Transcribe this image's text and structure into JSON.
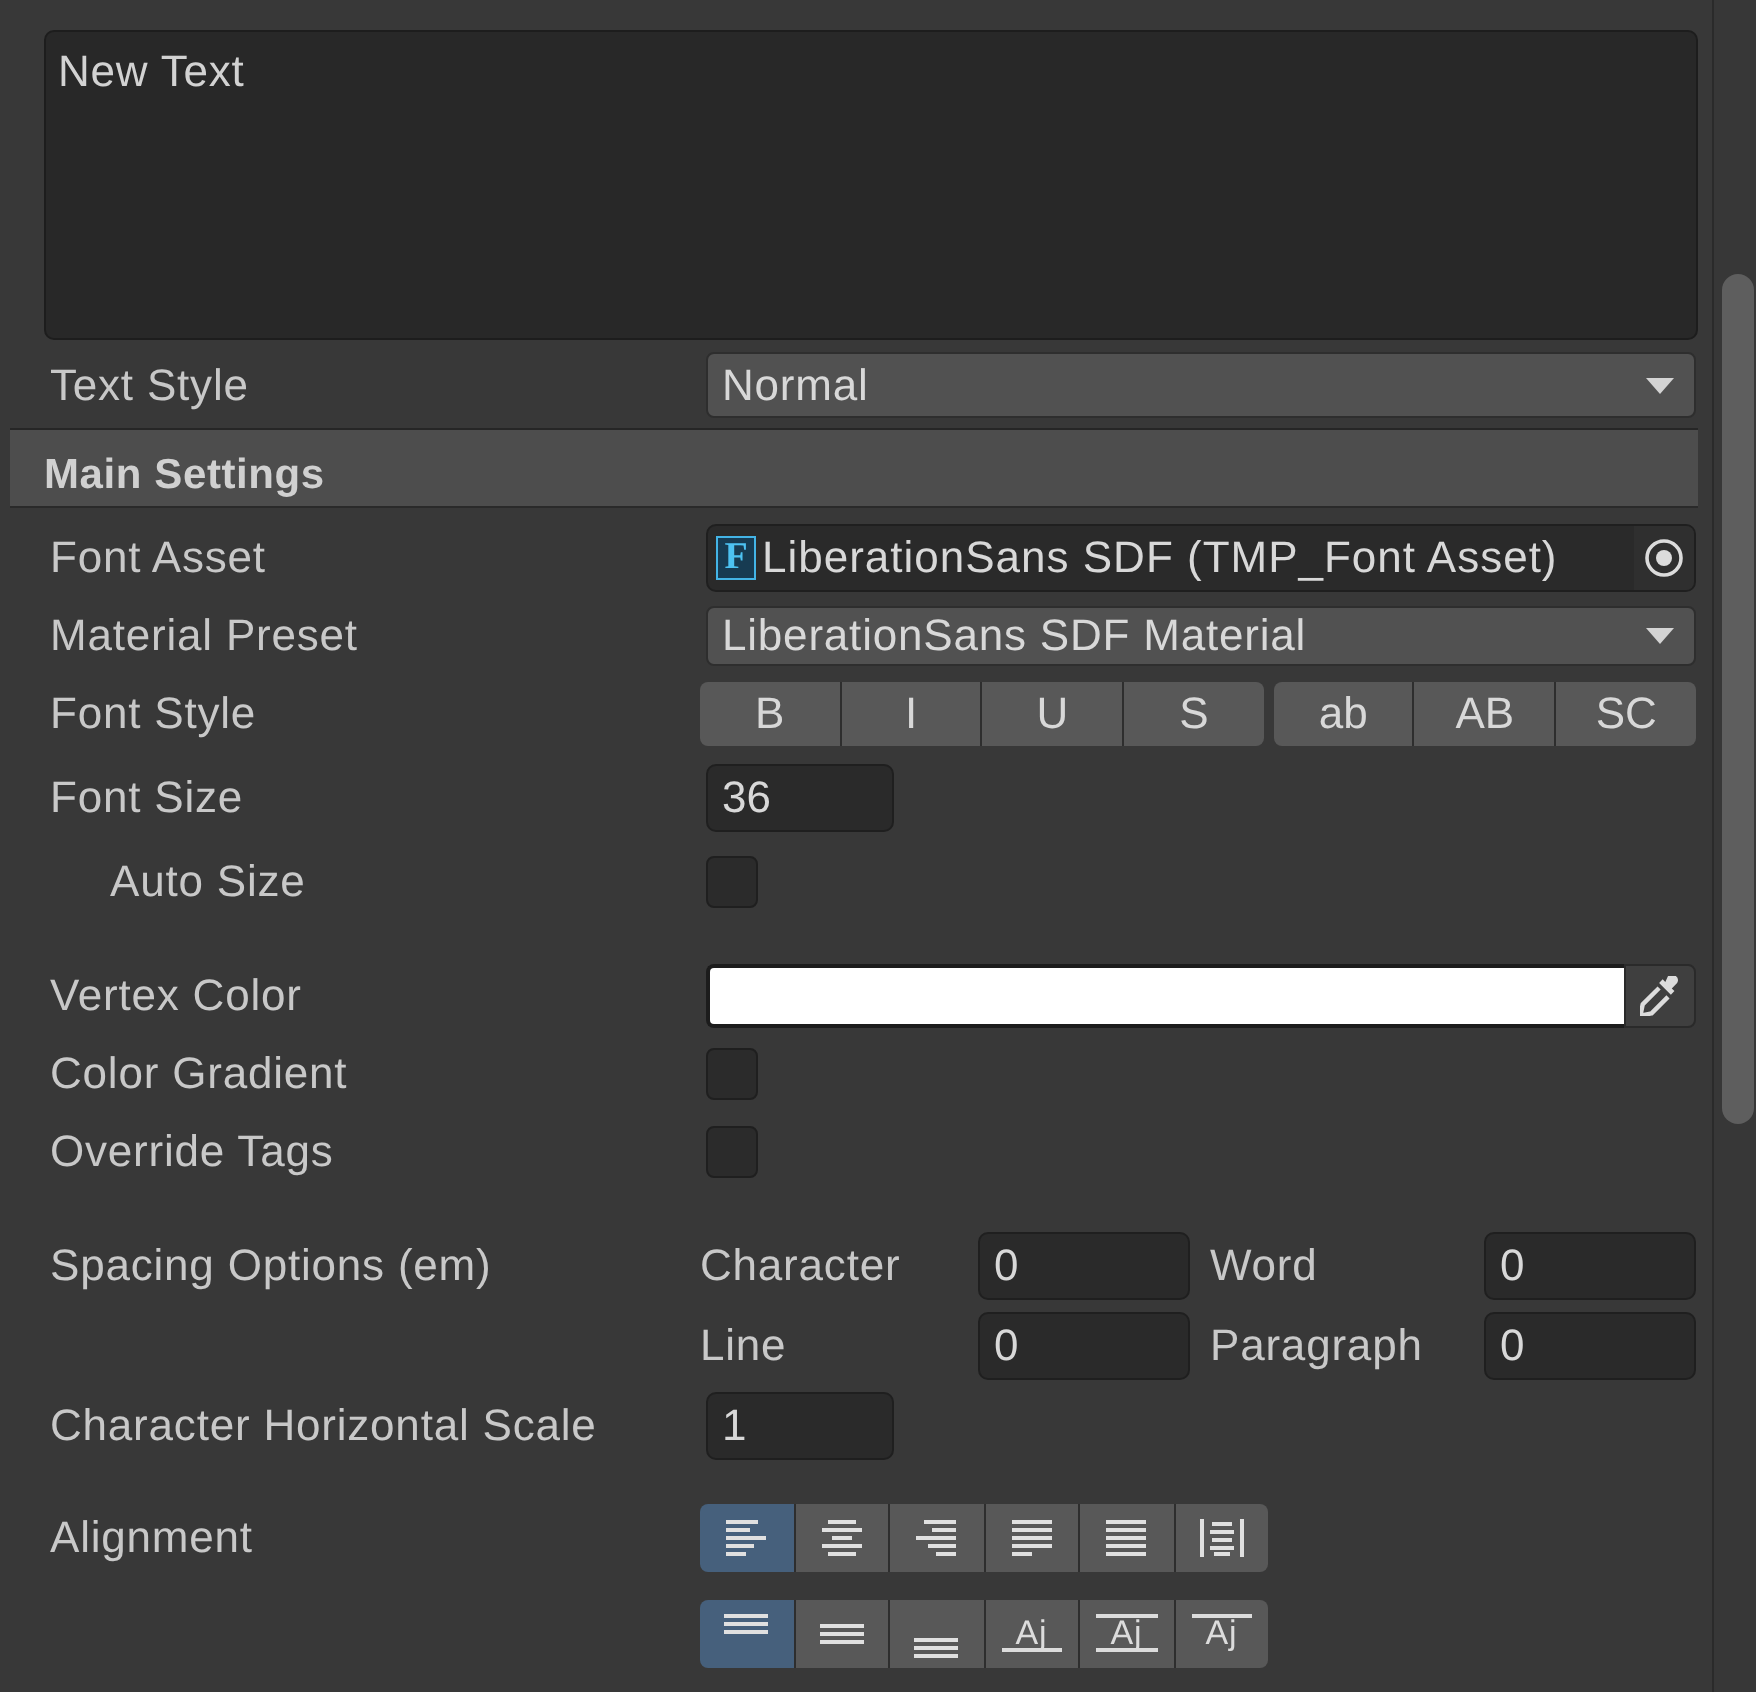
{
  "text_input": {
    "value": "New Text"
  },
  "text_style": {
    "label": "Text Style",
    "value": "Normal"
  },
  "main_settings": {
    "title": "Main Settings",
    "rows": [
      {
        "kind": "object",
        "label": "Font Asset",
        "icon": "F",
        "value": "LiberationSans SDF (TMP_Font Asset)"
      },
      {
        "kind": "dropdown",
        "label": "Material Preset",
        "value": "LiberationSans SDF Material"
      },
      {
        "kind": "toggles",
        "label": "Font Style",
        "groups": [
          [
            {
              "label": "B",
              "selected": false
            },
            {
              "label": "I",
              "selected": false
            },
            {
              "label": "U",
              "selected": false
            },
            {
              "label": "S",
              "selected": false
            }
          ],
          [
            {
              "label": "ab",
              "selected": false
            },
            {
              "label": "AB",
              "selected": false
            },
            {
              "label": "SC",
              "selected": false
            }
          ]
        ]
      },
      {
        "kind": "number",
        "label": "Font Size",
        "value": "36",
        "children": [
          {
            "kind": "checkbox",
            "label": "Auto Size",
            "checked": false
          }
        ]
      },
      {
        "kind": "color",
        "label": "Vertex Color",
        "color": "#ffffff"
      },
      {
        "kind": "checkbox",
        "label": "Color Gradient",
        "checked": false
      },
      {
        "kind": "checkbox",
        "label": "Override Tags",
        "checked": false
      },
      {
        "kind": "spacing",
        "label": "Spacing Options (em)",
        "fields": [
          {
            "label": "Character",
            "value": "0"
          },
          {
            "label": "Word",
            "value": "0"
          },
          {
            "label": "Line",
            "value": "0"
          },
          {
            "label": "Paragraph",
            "value": "0"
          }
        ]
      },
      {
        "kind": "number",
        "label": "Character Horizontal Scale",
        "value": "1"
      },
      {
        "kind": "alignment",
        "label": "Alignment",
        "rows": [
          [
            {
              "kind": "left",
              "selected": true
            },
            {
              "kind": "center",
              "selected": false
            },
            {
              "kind": "right",
              "selected": false
            },
            {
              "kind": "justified",
              "selected": false
            },
            {
              "kind": "flush",
              "selected": false
            },
            {
              "kind": "geometry",
              "selected": false
            }
          ],
          [
            {
              "kind": "top",
              "selected": true
            },
            {
              "kind": "middle",
              "selected": false
            },
            {
              "kind": "bottom",
              "selected": false
            },
            {
              "kind": "baseline",
              "glyph": "Aj",
              "selected": false
            },
            {
              "kind": "midline",
              "glyph": "Aj",
              "selected": false
            },
            {
              "kind": "capline",
              "glyph": "Aj",
              "selected": false
            }
          ]
        ]
      }
    ]
  }
}
